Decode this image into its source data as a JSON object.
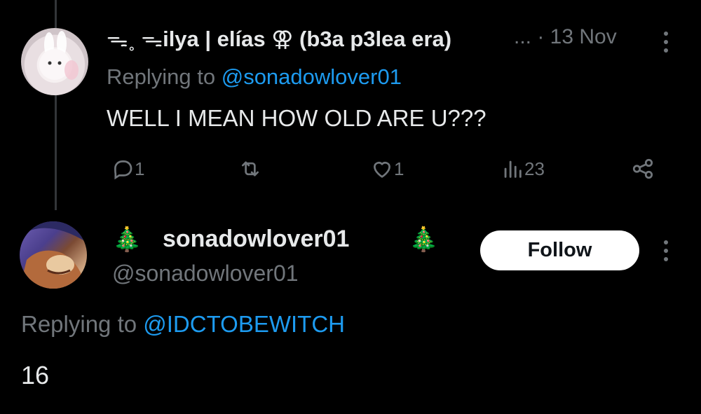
{
  "tweet1": {
    "author_name": "ilya | elías ⚢ (b3a p3lea era)",
    "name_prefix": "ᯓ˳ ᯓ",
    "ellipsis": "...",
    "timestamp": "· 13 Nov",
    "replying_prefix": "Replying to ",
    "replying_handle": "@sonadowlover01",
    "text": "WELL I MEAN HOW OLD ARE U???",
    "counts": {
      "replies": "1",
      "retweets": "",
      "likes": "1",
      "views": "23"
    }
  },
  "tweet2": {
    "tree_left": "🎄",
    "author_name": "sonadowlover01",
    "tree_right": "🎄",
    "handle": "@sonadowlover01",
    "follow_label": "Follow",
    "replying_prefix": "Replying to ",
    "replying_handle": "@IDCTOBEWITCH",
    "text": "16"
  },
  "icons": [
    "reply-icon",
    "retweet-icon",
    "like-icon",
    "views-icon",
    "share-icon",
    "more-icon"
  ],
  "colors": {
    "background": "#000000",
    "text": "#e7e9ea",
    "muted": "#71767b",
    "link": "#1d9bf0",
    "follow_bg": "#ffffff"
  }
}
